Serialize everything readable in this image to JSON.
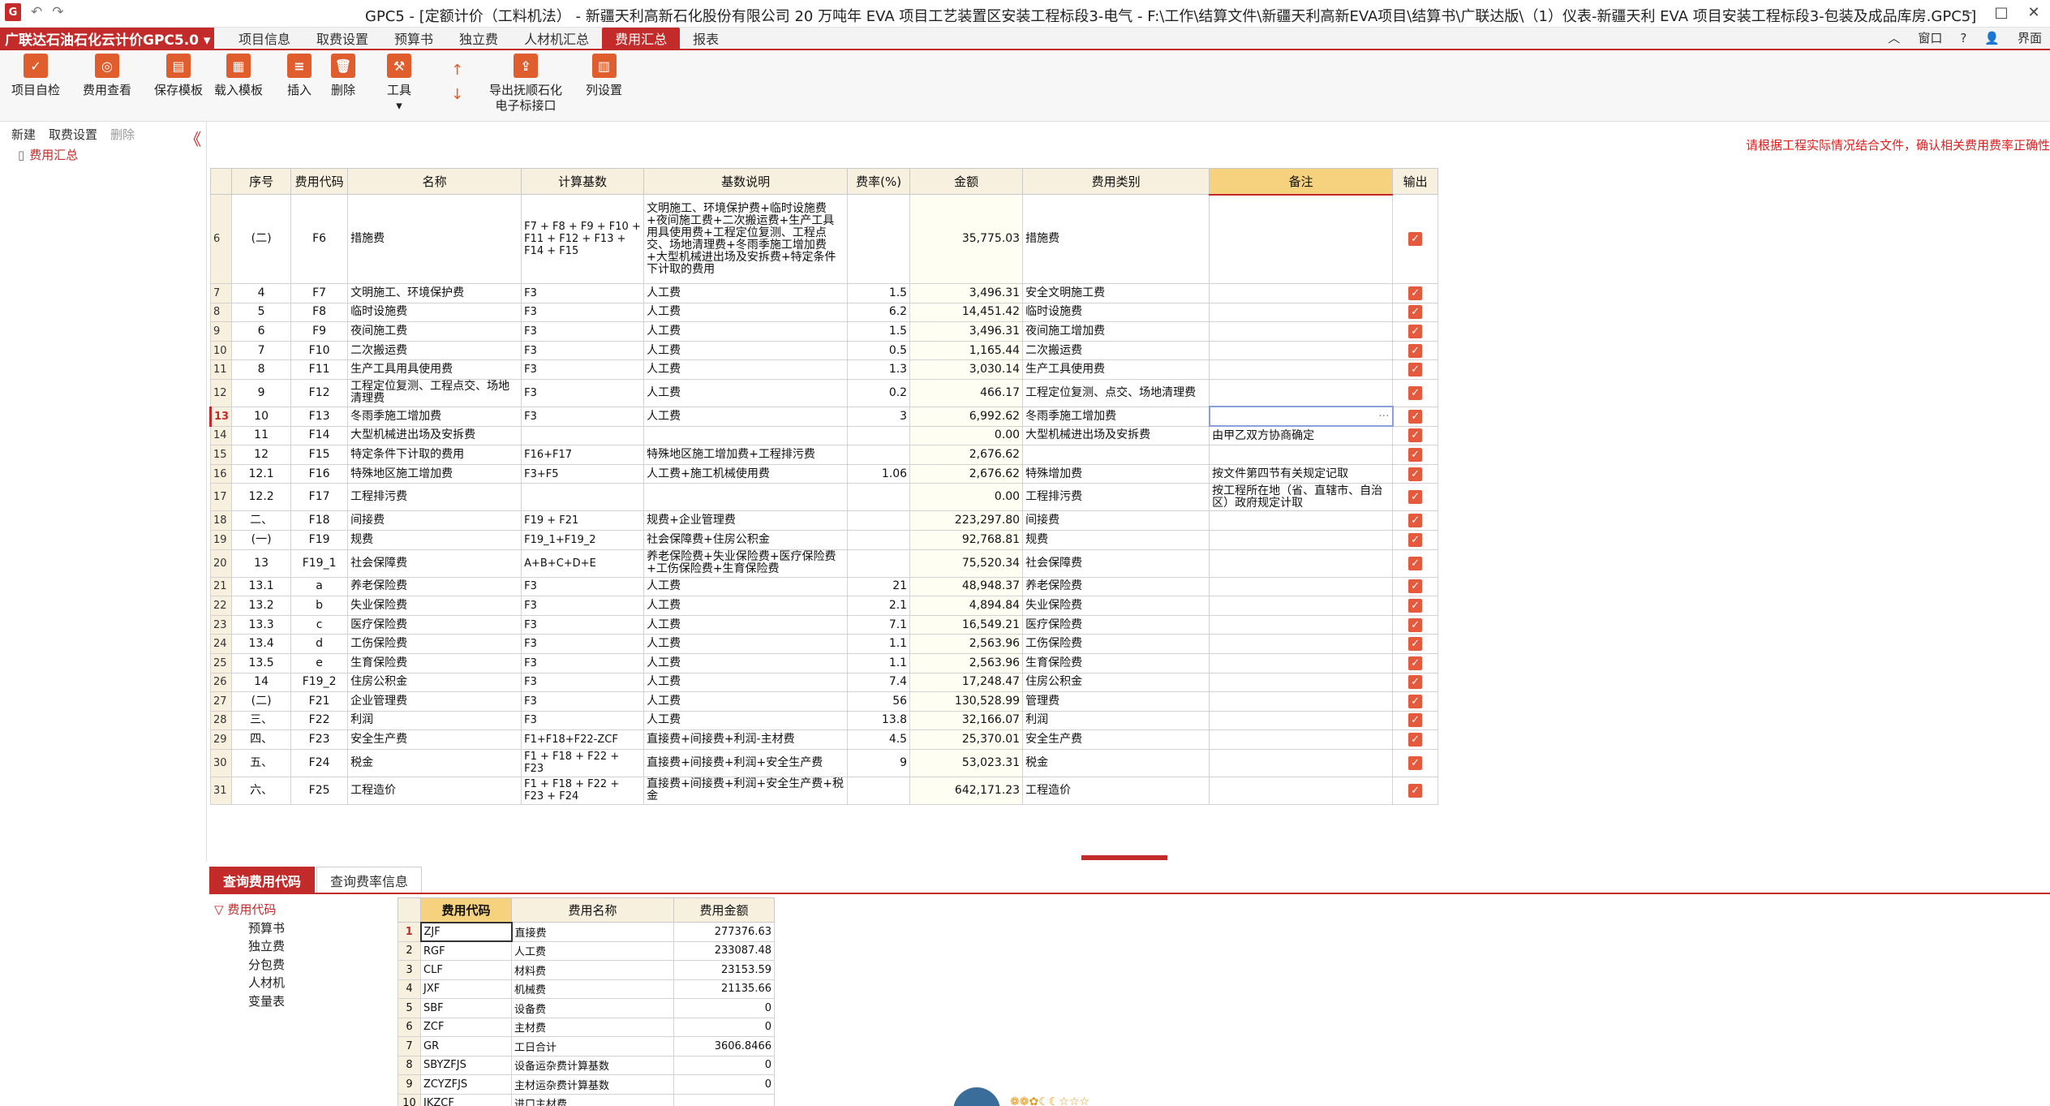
{
  "window": {
    "title": "GPC5 - [定额计价（工料机法） - 新疆天利高新石化股份有限公司 20 万吨年 EVA 项目工艺装置区安装工程标段3-电气 - F:\\工作\\结算文件\\新疆天利高新EVA项目\\结算书\\广联达版\\（1）仪表-新疆天利 EVA 项目安装工程标段3-包装及成品库房.GPC5]",
    "qa_undo": "↶",
    "qa_redo": "↷"
  },
  "menubar": {
    "brand": "广联达石油石化云计价GPC5.0 ▾",
    "tabs": [
      "项目信息",
      "取费设置",
      "预算书",
      "独立费",
      "人材机汇总",
      "费用汇总",
      "报表"
    ],
    "active": "费用汇总",
    "right": [
      "窗口",
      "界面"
    ]
  },
  "toolbar": {
    "buttons": [
      "项目自检",
      "费用查看",
      "保存模板",
      "载入模板",
      "插入",
      "删除",
      "工具",
      "导出抚顺石化\n电子标接口",
      "列设置"
    ],
    "up": "↑",
    "down": "↓"
  },
  "left": {
    "tabs": [
      "新建",
      "取费设置",
      "删除"
    ],
    "tree": "费用汇总",
    "collapse": "《"
  },
  "notice": "请根据工程实际情况结合文件，确认相关费用费率正确性",
  "grid": {
    "columns": [
      "序号",
      "费用代码",
      "名称",
      "计算基数",
      "基数说明",
      "费率(%)",
      "金额",
      "费用类别",
      "备注",
      "输出"
    ],
    "rows": [
      {
        "n": "6",
        "seq": "(二)",
        "code": "F6",
        "name": "措施费",
        "base": "F7 + F8 + F9 + F10 + F11 + F12 + F13 + F14 + F15",
        "desc": "文明施工、环境保护费+临时设施费+夜间施工费+二次搬运费+生产工具用具使用费+工程定位复测、工程点交、场地清理费+冬雨季施工增加费+大型机械进出场及安拆费+特定条件下计取的费用",
        "rate": "",
        "amt": "35,775.03",
        "cat": "措施费",
        "rem": ""
      },
      {
        "n": "7",
        "seq": "4",
        "code": "F7",
        "name": "文明施工、环境保护费",
        "base": "F3",
        "desc": "人工费",
        "rate": "1.5",
        "amt": "3,496.31",
        "cat": "安全文明施工费",
        "rem": ""
      },
      {
        "n": "8",
        "seq": "5",
        "code": "F8",
        "name": "临时设施费",
        "base": "F3",
        "desc": "人工费",
        "rate": "6.2",
        "amt": "14,451.42",
        "cat": "临时设施费",
        "rem": ""
      },
      {
        "n": "9",
        "seq": "6",
        "code": "F9",
        "name": "夜间施工费",
        "base": "F3",
        "desc": "人工费",
        "rate": "1.5",
        "amt": "3,496.31",
        "cat": "夜间施工增加费",
        "rem": ""
      },
      {
        "n": "10",
        "seq": "7",
        "code": "F10",
        "name": "二次搬运费",
        "base": "F3",
        "desc": "人工费",
        "rate": "0.5",
        "amt": "1,165.44",
        "cat": "二次搬运费",
        "rem": ""
      },
      {
        "n": "11",
        "seq": "8",
        "code": "F11",
        "name": "生产工具用具使用费",
        "base": "F3",
        "desc": "人工费",
        "rate": "1.3",
        "amt": "3,030.14",
        "cat": "生产工具使用费",
        "rem": ""
      },
      {
        "n": "12",
        "seq": "9",
        "code": "F12",
        "name": "工程定位复测、工程点交、场地清理费",
        "base": "F3",
        "desc": "人工费",
        "rate": "0.2",
        "amt": "466.17",
        "cat": "工程定位复测、点交、场地清理费",
        "rem": ""
      },
      {
        "n": "13",
        "seq": "10",
        "code": "F13",
        "name": "冬雨季施工增加费",
        "base": "F3",
        "desc": "人工费",
        "rate": "3",
        "amt": "6,992.62",
        "cat": "冬雨季施工增加费",
        "rem": "···"
      },
      {
        "n": "14",
        "seq": "11",
        "code": "F14",
        "name": "大型机械进出场及安拆费",
        "base": "",
        "desc": "",
        "rate": "",
        "amt": "0.00",
        "cat": "大型机械进出场及安拆费",
        "rem": "由甲乙双方协商确定"
      },
      {
        "n": "15",
        "seq": "12",
        "code": "F15",
        "name": "特定条件下计取的费用",
        "base": "F16+F17",
        "desc": "特殊地区施工增加费+工程排污费",
        "rate": "",
        "amt": "2,676.62",
        "cat": "",
        "rem": ""
      },
      {
        "n": "16",
        "seq": "12.1",
        "code": "F16",
        "name": "特殊地区施工增加费",
        "base": "F3+F5",
        "desc": "人工费+施工机械使用费",
        "rate": "1.06",
        "amt": "2,676.62",
        "cat": "特殊增加费",
        "rem": "按文件第四节有关规定记取"
      },
      {
        "n": "17",
        "seq": "12.2",
        "code": "F17",
        "name": "工程排污费",
        "base": "",
        "desc": "",
        "rate": "",
        "amt": "0.00",
        "cat": "工程排污费",
        "rem": "按工程所在地（省、直辖市、自治区）政府规定计取"
      },
      {
        "n": "18",
        "seq": "二、",
        "code": "F18",
        "name": "间接费",
        "base": "F19 + F21",
        "desc": "规费+企业管理费",
        "rate": "",
        "amt": "223,297.80",
        "cat": "间接费",
        "rem": ""
      },
      {
        "n": "19",
        "seq": "(一)",
        "code": "F19",
        "name": "规费",
        "base": "F19_1+F19_2",
        "desc": "社会保障费+住房公积金",
        "rate": "",
        "amt": "92,768.81",
        "cat": "规费",
        "rem": ""
      },
      {
        "n": "20",
        "seq": "13",
        "code": "F19_1",
        "name": "社会保障费",
        "base": "A+B+C+D+E",
        "desc": "养老保险费+失业保险费+医疗保险费+工伤保险费+生育保险费",
        "rate": "",
        "amt": "75,520.34",
        "cat": "社会保障费",
        "rem": ""
      },
      {
        "n": "21",
        "seq": "13.1",
        "code": "a",
        "name": "养老保险费",
        "base": "F3",
        "desc": "人工费",
        "rate": "21",
        "amt": "48,948.37",
        "cat": "养老保险费",
        "rem": ""
      },
      {
        "n": "22",
        "seq": "13.2",
        "code": "b",
        "name": "失业保险费",
        "base": "F3",
        "desc": "人工费",
        "rate": "2.1",
        "amt": "4,894.84",
        "cat": "失业保险费",
        "rem": ""
      },
      {
        "n": "23",
        "seq": "13.3",
        "code": "c",
        "name": "医疗保险费",
        "base": "F3",
        "desc": "人工费",
        "rate": "7.1",
        "amt": "16,549.21",
        "cat": "医疗保险费",
        "rem": ""
      },
      {
        "n": "24",
        "seq": "13.4",
        "code": "d",
        "name": "工伤保险费",
        "base": "F3",
        "desc": "人工费",
        "rate": "1.1",
        "amt": "2,563.96",
        "cat": "工伤保险费",
        "rem": ""
      },
      {
        "n": "25",
        "seq": "13.5",
        "code": "e",
        "name": "生育保险费",
        "base": "F3",
        "desc": "人工费",
        "rate": "1.1",
        "amt": "2,563.96",
        "cat": "生育保险费",
        "rem": ""
      },
      {
        "n": "26",
        "seq": "14",
        "code": "F19_2",
        "name": "住房公积金",
        "base": "F3",
        "desc": "人工费",
        "rate": "7.4",
        "amt": "17,248.47",
        "cat": "住房公积金",
        "rem": ""
      },
      {
        "n": "27",
        "seq": "(二)",
        "code": "F21",
        "name": "企业管理费",
        "base": "F3",
        "desc": "人工费",
        "rate": "56",
        "amt": "130,528.99",
        "cat": "管理费",
        "rem": ""
      },
      {
        "n": "28",
        "seq": "三、",
        "code": "F22",
        "name": "利润",
        "base": "F3",
        "desc": "人工费",
        "rate": "13.8",
        "amt": "32,166.07",
        "cat": "利润",
        "rem": ""
      },
      {
        "n": "29",
        "seq": "四、",
        "code": "F23",
        "name": "安全生产费",
        "base": "F1+F18+F22-ZCF",
        "desc": "直接费+间接费+利润-主材费",
        "rate": "4.5",
        "amt": "25,370.01",
        "cat": "安全生产费",
        "rem": ""
      },
      {
        "n": "30",
        "seq": "五、",
        "code": "F24",
        "name": "税金",
        "base": "F1 + F18 + F22 + F23",
        "desc": "直接费+间接费+利润+安全生产费",
        "rate": "9",
        "amt": "53,023.31",
        "cat": "税金",
        "rem": ""
      },
      {
        "n": "31",
        "seq": "六、",
        "code": "F25",
        "name": "工程造价",
        "base": "F1 + F18 + F22 + F23 + F24",
        "desc": "直接费+间接费+利润+安全生产费+税金",
        "rate": "",
        "amt": "642,171.23",
        "cat": "工程造价",
        "rem": ""
      }
    ]
  },
  "bottom": {
    "tabs": [
      "查询费用代码",
      "查询费率信息"
    ],
    "tree_root": "费用代码",
    "tree_children": [
      "预算书",
      "独立费",
      "分包费",
      "人材机",
      "变量表"
    ],
    "columns": [
      "费用代码",
      "费用名称",
      "费用金额"
    ],
    "rows": [
      {
        "n": "1",
        "code": "ZJF",
        "name": "直接费",
        "amt": "277376.63"
      },
      {
        "n": "2",
        "code": "RGF",
        "name": "人工费",
        "amt": "233087.48"
      },
      {
        "n": "3",
        "code": "CLF",
        "name": "材料费",
        "amt": "23153.59"
      },
      {
        "n": "4",
        "code": "JXF",
        "name": "机械费",
        "amt": "21135.66"
      },
      {
        "n": "5",
        "code": "SBF",
        "name": "设备费",
        "amt": "0"
      },
      {
        "n": "6",
        "code": "ZCF",
        "name": "主材费",
        "amt": "0"
      },
      {
        "n": "7",
        "code": "GR",
        "name": "工日合计",
        "amt": "3606.8466"
      },
      {
        "n": "8",
        "code": "SBYZFJS",
        "name": "设备运杂费计算基数",
        "amt": "0"
      },
      {
        "n": "9",
        "code": "ZCYZFJS",
        "name": "主材运杂费计算基数",
        "amt": "0"
      },
      {
        "n": "10",
        "code": "JKZCF",
        "name": "进口主材费",
        "amt": ""
      }
    ]
  },
  "status": "❁❁✿☾☾☆☆☆"
}
